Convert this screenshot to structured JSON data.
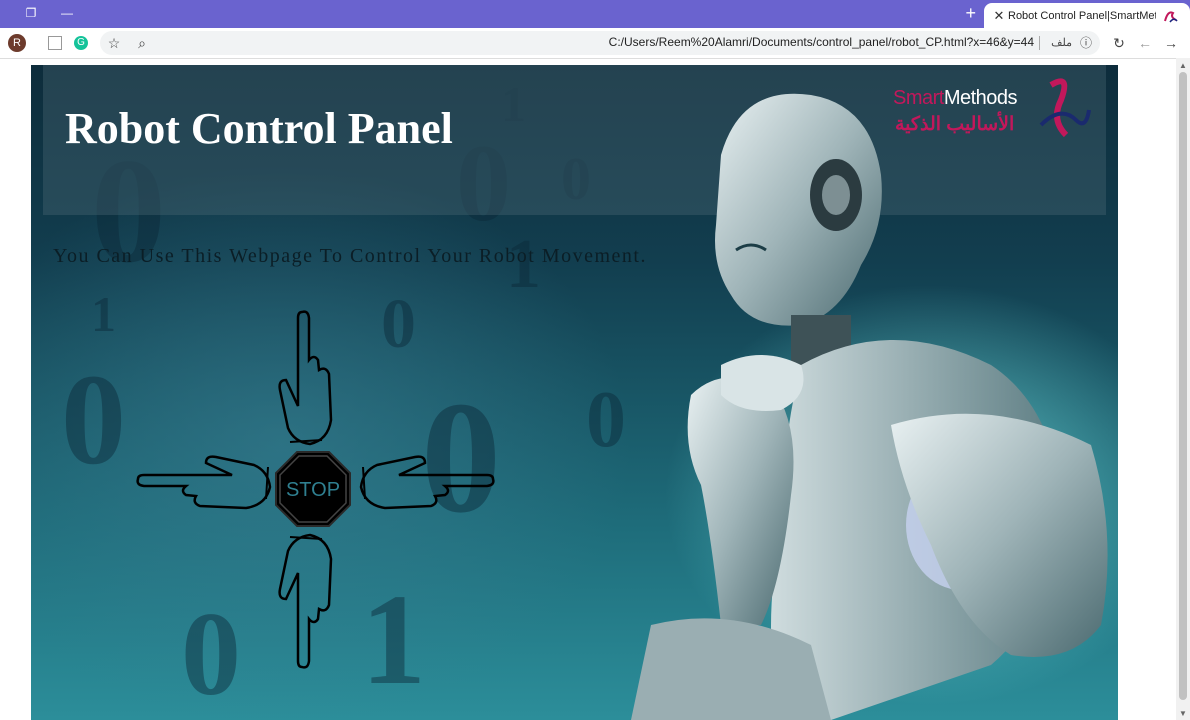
{
  "browser": {
    "tab_title": "Robot Control Panel|SmartMethods",
    "url": "C:/Users/Reem%20Alamri/Documents/control_panel/robot_CP.html?x=46&y=44",
    "file_label": "ملف",
    "profile_initial": "R",
    "icons": [
      "restore-icon",
      "minimize-icon",
      "new-tab-icon",
      "close-tab-icon",
      "grammarly-icon",
      "bookmark-star-icon",
      "zoom-icon",
      "info-icon",
      "reload-icon",
      "back-icon",
      "forward-icon"
    ]
  },
  "page": {
    "title": "Robot Control Panel",
    "subtitle": "You Can Use This Webpage To Control Your Robot Movement.",
    "logo": {
      "en_prefix": "Smart",
      "en_suffix": "Methods",
      "ar": "الأساليب الذكية"
    },
    "controls": {
      "stop_label": "STOP",
      "directions": [
        "forward",
        "left",
        "right",
        "backward"
      ]
    }
  },
  "colors": {
    "titlebar": "#6a63cf",
    "accent_logo": "#c2185b",
    "page_bg_dark": "#0d2c3b",
    "page_bg_teal": "#2c8e9a"
  }
}
